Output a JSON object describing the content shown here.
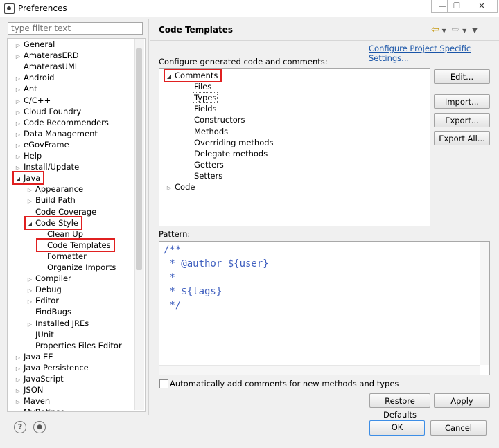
{
  "window": {
    "title": "Preferences"
  },
  "filter": {
    "placeholder": "type filter text"
  },
  "tree": [
    {
      "label": "General",
      "level": 0,
      "arrow": "right"
    },
    {
      "label": "AmaterasERD",
      "level": 0,
      "arrow": "right"
    },
    {
      "label": "AmaterasUML",
      "level": 0,
      "arrow": "none"
    },
    {
      "label": "Android",
      "level": 0,
      "arrow": "right"
    },
    {
      "label": "Ant",
      "level": 0,
      "arrow": "right"
    },
    {
      "label": "C/C++",
      "level": 0,
      "arrow": "right"
    },
    {
      "label": "Cloud Foundry",
      "level": 0,
      "arrow": "right"
    },
    {
      "label": "Code Recommenders",
      "level": 0,
      "arrow": "right"
    },
    {
      "label": "Data Management",
      "level": 0,
      "arrow": "right"
    },
    {
      "label": "eGovFrame",
      "level": 0,
      "arrow": "right"
    },
    {
      "label": "Help",
      "level": 0,
      "arrow": "right"
    },
    {
      "label": "Install/Update",
      "level": 0,
      "arrow": "right"
    },
    {
      "label": "Java",
      "level": 0,
      "arrow": "down",
      "highlight": true
    },
    {
      "label": "Appearance",
      "level": 1,
      "arrow": "right"
    },
    {
      "label": "Build Path",
      "level": 1,
      "arrow": "right"
    },
    {
      "label": "Code Coverage",
      "level": 1,
      "arrow": "none"
    },
    {
      "label": "Code Style",
      "level": 1,
      "arrow": "down",
      "highlight": true
    },
    {
      "label": "Clean Up",
      "level": 2,
      "arrow": "none"
    },
    {
      "label": "Code Templates",
      "level": 2,
      "arrow": "none",
      "highlight": true
    },
    {
      "label": "Formatter",
      "level": 2,
      "arrow": "none"
    },
    {
      "label": "Organize Imports",
      "level": 2,
      "arrow": "none"
    },
    {
      "label": "Compiler",
      "level": 1,
      "arrow": "right"
    },
    {
      "label": "Debug",
      "level": 1,
      "arrow": "right"
    },
    {
      "label": "Editor",
      "level": 1,
      "arrow": "right"
    },
    {
      "label": "FindBugs",
      "level": 1,
      "arrow": "none"
    },
    {
      "label": "Installed JREs",
      "level": 1,
      "arrow": "right"
    },
    {
      "label": "JUnit",
      "level": 1,
      "arrow": "none"
    },
    {
      "label": "Properties Files Editor",
      "level": 1,
      "arrow": "none"
    },
    {
      "label": "Java EE",
      "level": 0,
      "arrow": "right"
    },
    {
      "label": "Java Persistence",
      "level": 0,
      "arrow": "right"
    },
    {
      "label": "JavaScript",
      "level": 0,
      "arrow": "right"
    },
    {
      "label": "JSON",
      "level": 0,
      "arrow": "right"
    },
    {
      "label": "Maven",
      "level": 0,
      "arrow": "right"
    },
    {
      "label": "MyBatipse",
      "level": 0,
      "arrow": "right"
    }
  ],
  "page": {
    "title": "Code Templates",
    "link": "Configure Project Specific Settings...",
    "config_label": "Configure generated code and comments:",
    "pattern_label": "Pattern:",
    "auto_comment_label": "Automatically add comments for new methods and types"
  },
  "templates": [
    {
      "label": "Comments",
      "level": 0,
      "arrow": "down",
      "highlight": true
    },
    {
      "label": "Files",
      "level": 1,
      "arrow": "none"
    },
    {
      "label": "Types",
      "level": 1,
      "arrow": "none",
      "selected": true
    },
    {
      "label": "Fields",
      "level": 1,
      "arrow": "none"
    },
    {
      "label": "Constructors",
      "level": 1,
      "arrow": "none"
    },
    {
      "label": "Methods",
      "level": 1,
      "arrow": "none"
    },
    {
      "label": "Overriding methods",
      "level": 1,
      "arrow": "none"
    },
    {
      "label": "Delegate methods",
      "level": 1,
      "arrow": "none"
    },
    {
      "label": "Getters",
      "level": 1,
      "arrow": "none"
    },
    {
      "label": "Setters",
      "level": 1,
      "arrow": "none"
    },
    {
      "label": "Code",
      "level": 0,
      "arrow": "right"
    }
  ],
  "pattern_text": "/**\n * @author ${user}\n *\n * ${tags}\n */",
  "buttons": {
    "edit": "Edit...",
    "import": "Import...",
    "export": "Export...",
    "export_all": "Export All...",
    "restore": "Restore Defaults",
    "apply": "Apply",
    "ok": "OK",
    "cancel": "Cancel"
  },
  "icons": {
    "help": "?",
    "record": "●"
  }
}
